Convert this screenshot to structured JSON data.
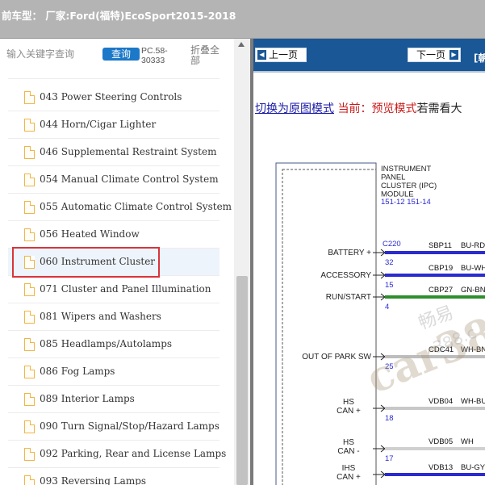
{
  "header": {
    "title": "前车型： 厂家:Ford(福特)EcoSport2015-2018"
  },
  "search": {
    "placeholder": "输入关键字查询",
    "query_button": "查询",
    "code": "PC.58-30333",
    "collapse_all": "折叠全部"
  },
  "tree": {
    "items": [
      {
        "label": "043 Power Steering Controls"
      },
      {
        "label": "044 Horn/Cigar Lighter"
      },
      {
        "label": "046 Supplemental Restraint System"
      },
      {
        "label": "054 Manual Climate Control System"
      },
      {
        "label": "055 Automatic Climate Control System"
      },
      {
        "label": "056 Heated Window"
      },
      {
        "label": "060 Instrument Cluster",
        "selected": true
      },
      {
        "label": "071 Cluster and Panel Illumination"
      },
      {
        "label": "081 Wipers and Washers"
      },
      {
        "label": "085 Headlamps/Autolamps"
      },
      {
        "label": "086 Fog Lamps"
      },
      {
        "label": "089 Interior Lamps"
      },
      {
        "label": "090 Turn Signal/Stop/Hazard Lamps"
      },
      {
        "label": "092 Parking, Rear and License Lamps"
      },
      {
        "label": "093 Reversing Lamps"
      }
    ]
  },
  "viewer": {
    "prev_button": "上一页",
    "next_button": "下一页",
    "nav_extra": "[朝",
    "switch_link": "切换为原图模式",
    "current_label": "当前：预览模式",
    "tail_text": "若需看大"
  },
  "diagram": {
    "module_title": [
      "INSTRUMENT",
      "PANEL",
      "CLUSTER (IPC)",
      "MODULE"
    ],
    "module_refs": "151-12  151-14",
    "connector": "C220",
    "pins": [
      {
        "label": "BATTERY +",
        "pin": "32",
        "circuit": "SBP11",
        "color": "BU-RD",
        "wire": "#2b2bd0"
      },
      {
        "label": "ACCESSORY",
        "pin": "15",
        "circuit": "CBP19",
        "color": "BU-WH",
        "wire": "#2b2bd0"
      },
      {
        "label": "RUN/START",
        "pin": "4",
        "circuit": "CBP27",
        "color": "GN-BN",
        "wire": "#2d8f2d"
      },
      {
        "label": "OUT OF PARK SW",
        "pin": "25",
        "circuit": "CDC41",
        "color": "WH-BN",
        "wire": "#bdbdbd"
      },
      {
        "label": "HS CAN +",
        "pin": "18",
        "circuit": "VDB04",
        "color": "WH-BU",
        "wire": "#c8c8c8"
      },
      {
        "label": "HS CAN -",
        "pin": "17",
        "circuit": "VDB05",
        "color": "WH",
        "wire": "#d0d0d0"
      },
      {
        "label": "IHS CAN +",
        "pin": "",
        "circuit": "VDB13",
        "color": "BU-GY",
        "wire": "#2b2bd0"
      }
    ],
    "watermarks": [
      "畅易",
      "car388",
      "388.c"
    ]
  },
  "colors": {
    "header_bg": "#b4b4b4",
    "query_button_bg": "#1c78c8",
    "nav_bar_bg": "#1a5796",
    "highlight_border": "#d9343a",
    "folder_icon": "#f0b547"
  }
}
